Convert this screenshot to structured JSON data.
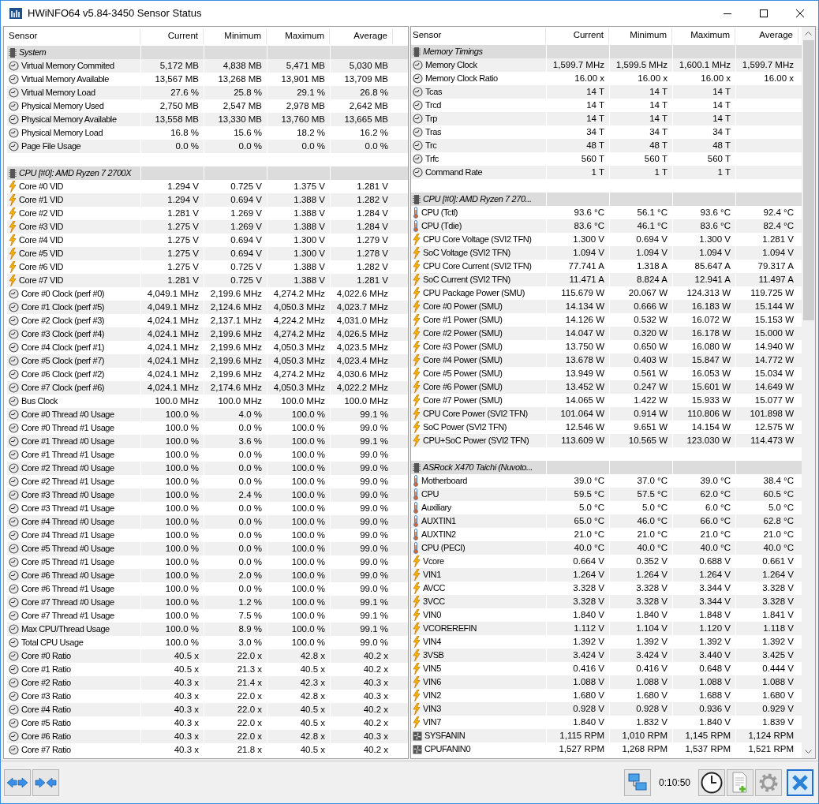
{
  "window": {
    "title": "HWiNFO64 v5.84-3450 Sensor Status"
  },
  "panes": [
    {
      "columns": [
        "Sensor",
        "Current",
        "Minimum",
        "Maximum",
        "Average"
      ],
      "rows": [
        {
          "kind": "group",
          "name": "System"
        },
        {
          "kind": "clock",
          "name": "Virtual Memory Commited",
          "values": [
            "5,172 MB",
            "4,838 MB",
            "5,471 MB",
            "5,030 MB"
          ]
        },
        {
          "kind": "clock",
          "name": "Virtual Memory Available",
          "values": [
            "13,567 MB",
            "13,268 MB",
            "13,901 MB",
            "13,709 MB"
          ]
        },
        {
          "kind": "clock",
          "name": "Virtual Memory Load",
          "values": [
            "27.6 %",
            "25.8 %",
            "29.1 %",
            "26.8 %"
          ]
        },
        {
          "kind": "clock",
          "name": "Physical Memory Used",
          "values": [
            "2,750 MB",
            "2,547 MB",
            "2,978 MB",
            "2,642 MB"
          ]
        },
        {
          "kind": "clock",
          "name": "Physical Memory Available",
          "values": [
            "13,558 MB",
            "13,330 MB",
            "13,760 MB",
            "13,665 MB"
          ]
        },
        {
          "kind": "clock",
          "name": "Physical Memory Load",
          "values": [
            "16.8 %",
            "15.6 %",
            "18.2 %",
            "16.2 %"
          ]
        },
        {
          "kind": "clock",
          "name": "Page File Usage",
          "values": [
            "0.0 %",
            "0.0 %",
            "0.0 %",
            "0.0 %"
          ]
        },
        {
          "kind": "spacer"
        },
        {
          "kind": "group",
          "name": "CPU [#0]: AMD Ryzen 7 2700X"
        },
        {
          "kind": "voltage",
          "name": "Core #0 VID",
          "values": [
            "1.294 V",
            "0.725 V",
            "1.375 V",
            "1.281 V"
          ]
        },
        {
          "kind": "voltage",
          "name": "Core #1 VID",
          "values": [
            "1.294 V",
            "0.694 V",
            "1.388 V",
            "1.282 V"
          ]
        },
        {
          "kind": "voltage",
          "name": "Core #2 VID",
          "values": [
            "1.281 V",
            "1.269 V",
            "1.388 V",
            "1.284 V"
          ]
        },
        {
          "kind": "voltage",
          "name": "Core #3 VID",
          "values": [
            "1.275 V",
            "1.269 V",
            "1.388 V",
            "1.284 V"
          ]
        },
        {
          "kind": "voltage",
          "name": "Core #4 VID",
          "values": [
            "1.275 V",
            "0.694 V",
            "1.300 V",
            "1.279 V"
          ]
        },
        {
          "kind": "voltage",
          "name": "Core #5 VID",
          "values": [
            "1.275 V",
            "0.694 V",
            "1.300 V",
            "1.278 V"
          ]
        },
        {
          "kind": "voltage",
          "name": "Core #6 VID",
          "values": [
            "1.275 V",
            "0.725 V",
            "1.388 V",
            "1.282 V"
          ]
        },
        {
          "kind": "voltage",
          "name": "Core #7 VID",
          "values": [
            "1.281 V",
            "0.725 V",
            "1.388 V",
            "1.281 V"
          ]
        },
        {
          "kind": "clock",
          "name": "Core #0 Clock (perf #0)",
          "values": [
            "4,049.1 MHz",
            "2,199.6 MHz",
            "4,274.2 MHz",
            "4,022.6 MHz"
          ]
        },
        {
          "kind": "clock",
          "name": "Core #1 Clock (perf #5)",
          "values": [
            "4,049.1 MHz",
            "2,124.6 MHz",
            "4,050.3 MHz",
            "4,023.7 MHz"
          ]
        },
        {
          "kind": "clock",
          "name": "Core #2 Clock (perf #3)",
          "values": [
            "4,024.1 MHz",
            "2,137.1 MHz",
            "4,224.2 MHz",
            "4,031.0 MHz"
          ]
        },
        {
          "kind": "clock",
          "name": "Core #3 Clock (perf #4)",
          "values": [
            "4,024.1 MHz",
            "2,199.6 MHz",
            "4,274.2 MHz",
            "4,026.5 MHz"
          ]
        },
        {
          "kind": "clock",
          "name": "Core #4 Clock (perf #1)",
          "values": [
            "4,024.1 MHz",
            "2,199.6 MHz",
            "4,050.3 MHz",
            "4,023.5 MHz"
          ]
        },
        {
          "kind": "clock",
          "name": "Core #5 Clock (perf #7)",
          "values": [
            "4,024.1 MHz",
            "2,199.6 MHz",
            "4,050.3 MHz",
            "4,023.4 MHz"
          ]
        },
        {
          "kind": "clock",
          "name": "Core #6 Clock (perf #2)",
          "values": [
            "4,024.1 MHz",
            "2,199.6 MHz",
            "4,274.2 MHz",
            "4,030.6 MHz"
          ]
        },
        {
          "kind": "clock",
          "name": "Core #7 Clock (perf #6)",
          "values": [
            "4,024.1 MHz",
            "2,174.6 MHz",
            "4,050.3 MHz",
            "4,022.2 MHz"
          ]
        },
        {
          "kind": "clock",
          "name": "Bus Clock",
          "values": [
            "100.0 MHz",
            "100.0 MHz",
            "100.0 MHz",
            "100.0 MHz"
          ]
        },
        {
          "kind": "clock",
          "name": "Core #0 Thread #0 Usage",
          "values": [
            "100.0 %",
            "4.0 %",
            "100.0 %",
            "99.1 %"
          ]
        },
        {
          "kind": "clock",
          "name": "Core #0 Thread #1 Usage",
          "values": [
            "100.0 %",
            "0.0 %",
            "100.0 %",
            "99.0 %"
          ]
        },
        {
          "kind": "clock",
          "name": "Core #1 Thread #0 Usage",
          "values": [
            "100.0 %",
            "3.6 %",
            "100.0 %",
            "99.1 %"
          ]
        },
        {
          "kind": "clock",
          "name": "Core #1 Thread #1 Usage",
          "values": [
            "100.0 %",
            "0.0 %",
            "100.0 %",
            "99.0 %"
          ]
        },
        {
          "kind": "clock",
          "name": "Core #2 Thread #0 Usage",
          "values": [
            "100.0 %",
            "0.0 %",
            "100.0 %",
            "99.0 %"
          ]
        },
        {
          "kind": "clock",
          "name": "Core #2 Thread #1 Usage",
          "values": [
            "100.0 %",
            "0.0 %",
            "100.0 %",
            "99.0 %"
          ]
        },
        {
          "kind": "clock",
          "name": "Core #3 Thread #0 Usage",
          "values": [
            "100.0 %",
            "2.4 %",
            "100.0 %",
            "99.0 %"
          ]
        },
        {
          "kind": "clock",
          "name": "Core #3 Thread #1 Usage",
          "values": [
            "100.0 %",
            "0.0 %",
            "100.0 %",
            "99.0 %"
          ]
        },
        {
          "kind": "clock",
          "name": "Core #4 Thread #0 Usage",
          "values": [
            "100.0 %",
            "0.0 %",
            "100.0 %",
            "99.0 %"
          ]
        },
        {
          "kind": "clock",
          "name": "Core #4 Thread #1 Usage",
          "values": [
            "100.0 %",
            "0.0 %",
            "100.0 %",
            "99.0 %"
          ]
        },
        {
          "kind": "clock",
          "name": "Core #5 Thread #0 Usage",
          "values": [
            "100.0 %",
            "0.0 %",
            "100.0 %",
            "99.0 %"
          ]
        },
        {
          "kind": "clock",
          "name": "Core #5 Thread #1 Usage",
          "values": [
            "100.0 %",
            "0.0 %",
            "100.0 %",
            "99.0 %"
          ]
        },
        {
          "kind": "clock",
          "name": "Core #6 Thread #0 Usage",
          "values": [
            "100.0 %",
            "2.0 %",
            "100.0 %",
            "99.0 %"
          ]
        },
        {
          "kind": "clock",
          "name": "Core #6 Thread #1 Usage",
          "values": [
            "100.0 %",
            "0.0 %",
            "100.0 %",
            "99.0 %"
          ]
        },
        {
          "kind": "clock",
          "name": "Core #7 Thread #0 Usage",
          "values": [
            "100.0 %",
            "1.2 %",
            "100.0 %",
            "99.1 %"
          ]
        },
        {
          "kind": "clock",
          "name": "Core #7 Thread #1 Usage",
          "values": [
            "100.0 %",
            "7.5 %",
            "100.0 %",
            "99.1 %"
          ]
        },
        {
          "kind": "clock",
          "name": "Max CPU/Thread Usage",
          "values": [
            "100.0 %",
            "8.9 %",
            "100.0 %",
            "99.1 %"
          ]
        },
        {
          "kind": "clock",
          "name": "Total CPU Usage",
          "values": [
            "100.0 %",
            "3.0 %",
            "100.0 %",
            "99.0 %"
          ]
        },
        {
          "kind": "clock",
          "name": "Core #0 Ratio",
          "values": [
            "40.5 x",
            "22.0 x",
            "42.8 x",
            "40.2 x"
          ]
        },
        {
          "kind": "clock",
          "name": "Core #1 Ratio",
          "values": [
            "40.5 x",
            "21.3 x",
            "40.5 x",
            "40.2 x"
          ]
        },
        {
          "kind": "clock",
          "name": "Core #2 Ratio",
          "values": [
            "40.3 x",
            "21.4 x",
            "42.3 x",
            "40.3 x"
          ]
        },
        {
          "kind": "clock",
          "name": "Core #3 Ratio",
          "values": [
            "40.3 x",
            "22.0 x",
            "42.8 x",
            "40.3 x"
          ]
        },
        {
          "kind": "clock",
          "name": "Core #4 Ratio",
          "values": [
            "40.3 x",
            "22.0 x",
            "40.5 x",
            "40.2 x"
          ]
        },
        {
          "kind": "clock",
          "name": "Core #5 Ratio",
          "values": [
            "40.3 x",
            "22.0 x",
            "40.5 x",
            "40.2 x"
          ]
        },
        {
          "kind": "clock",
          "name": "Core #6 Ratio",
          "values": [
            "40.3 x",
            "22.0 x",
            "42.8 x",
            "40.3 x"
          ]
        },
        {
          "kind": "clock",
          "name": "Core #7 Ratio",
          "values": [
            "40.3 x",
            "21.8 x",
            "40.5 x",
            "40.2 x"
          ]
        }
      ]
    },
    {
      "columns": [
        "Sensor",
        "Current",
        "Minimum",
        "Maximum",
        "Average"
      ],
      "rows": [
        {
          "kind": "group",
          "name": "Memory Timings"
        },
        {
          "kind": "clock",
          "name": "Memory Clock",
          "values": [
            "1,599.7 MHz",
            "1,599.5 MHz",
            "1,600.1 MHz",
            "1,599.7 MHz"
          ]
        },
        {
          "kind": "clock",
          "name": "Memory Clock Ratio",
          "values": [
            "16.00 x",
            "16.00 x",
            "16.00 x",
            "16.00 x"
          ]
        },
        {
          "kind": "clock",
          "name": "Tcas",
          "values": [
            "14 T",
            "14 T",
            "14 T"
          ]
        },
        {
          "kind": "clock",
          "name": "Trcd",
          "values": [
            "14 T",
            "14 T",
            "14 T"
          ]
        },
        {
          "kind": "clock",
          "name": "Trp",
          "values": [
            "14 T",
            "14 T",
            "14 T"
          ]
        },
        {
          "kind": "clock",
          "name": "Tras",
          "values": [
            "34 T",
            "34 T",
            "34 T"
          ]
        },
        {
          "kind": "clock",
          "name": "Trc",
          "values": [
            "48 T",
            "48 T",
            "48 T"
          ]
        },
        {
          "kind": "clock",
          "name": "Trfc",
          "values": [
            "560 T",
            "560 T",
            "560 T"
          ]
        },
        {
          "kind": "clock",
          "name": "Command Rate",
          "values": [
            "1 T",
            "1 T",
            "1 T"
          ]
        },
        {
          "kind": "spacer"
        },
        {
          "kind": "group",
          "name": "CPU [#0]: AMD Ryzen 7 270..."
        },
        {
          "kind": "temperature",
          "name": "CPU (Tctl)",
          "values": [
            "93.6 °C",
            "56.1 °C",
            "93.6 °C",
            "92.4 °C"
          ]
        },
        {
          "kind": "temperature",
          "name": "CPU (Tdie)",
          "values": [
            "83.6 °C",
            "46.1 °C",
            "83.6 °C",
            "82.4 °C"
          ]
        },
        {
          "kind": "voltage",
          "name": "CPU Core Voltage (SVI2 TFN)",
          "values": [
            "1.300 V",
            "0.694 V",
            "1.300 V",
            "1.281 V"
          ]
        },
        {
          "kind": "voltage",
          "name": "SoC Voltage (SVI2 TFN)",
          "values": [
            "1.094 V",
            "1.094 V",
            "1.094 V",
            "1.094 V"
          ]
        },
        {
          "kind": "voltage",
          "name": "CPU Core Current (SVI2 TFN)",
          "values": [
            "77.741 A",
            "1.318 A",
            "85.647 A",
            "79.317 A"
          ]
        },
        {
          "kind": "voltage",
          "name": "SoC Current (SVI2 TFN)",
          "values": [
            "11.471 A",
            "8.824 A",
            "12.941 A",
            "11.497 A"
          ]
        },
        {
          "kind": "voltage",
          "name": "CPU Package Power (SMU)",
          "values": [
            "115.679 W",
            "20.067 W",
            "124.313 W",
            "119.725 W"
          ]
        },
        {
          "kind": "voltage",
          "name": "Core #0 Power (SMU)",
          "values": [
            "14.134 W",
            "0.666 W",
            "16.183 W",
            "15.144 W"
          ]
        },
        {
          "kind": "voltage",
          "name": "Core #1 Power (SMU)",
          "values": [
            "14.126 W",
            "0.532 W",
            "16.072 W",
            "15.153 W"
          ]
        },
        {
          "kind": "voltage",
          "name": "Core #2 Power (SMU)",
          "values": [
            "14.047 W",
            "0.320 W",
            "16.178 W",
            "15.000 W"
          ]
        },
        {
          "kind": "voltage",
          "name": "Core #3 Power (SMU)",
          "values": [
            "13.750 W",
            "0.650 W",
            "16.080 W",
            "14.940 W"
          ]
        },
        {
          "kind": "voltage",
          "name": "Core #4 Power (SMU)",
          "values": [
            "13.678 W",
            "0.403 W",
            "15.847 W",
            "14.772 W"
          ]
        },
        {
          "kind": "voltage",
          "name": "Core #5 Power (SMU)",
          "values": [
            "13.949 W",
            "0.561 W",
            "16.053 W",
            "15.034 W"
          ]
        },
        {
          "kind": "voltage",
          "name": "Core #6 Power (SMU)",
          "values": [
            "13.452 W",
            "0.247 W",
            "15.601 W",
            "14.649 W"
          ]
        },
        {
          "kind": "voltage",
          "name": "Core #7 Power (SMU)",
          "values": [
            "14.065 W",
            "1.422 W",
            "15.933 W",
            "15.077 W"
          ]
        },
        {
          "kind": "voltage",
          "name": "CPU Core Power (SVI2 TFN)",
          "values": [
            "101.064 W",
            "0.914 W",
            "110.806 W",
            "101.898 W"
          ]
        },
        {
          "kind": "voltage",
          "name": "SoC Power (SVI2 TFN)",
          "values": [
            "12.546 W",
            "9.651 W",
            "14.154 W",
            "12.575 W"
          ]
        },
        {
          "kind": "voltage",
          "name": "CPU+SoC Power (SVI2 TFN)",
          "values": [
            "113.609 W",
            "10.565 W",
            "123.030 W",
            "114.473 W"
          ]
        },
        {
          "kind": "spacer"
        },
        {
          "kind": "group",
          "name": "ASRock X470 Taichi (Nuvoto..."
        },
        {
          "kind": "temperature",
          "name": "Motherboard",
          "values": [
            "39.0 °C",
            "37.0 °C",
            "39.0 °C",
            "38.4 °C"
          ]
        },
        {
          "kind": "temperature",
          "name": "CPU",
          "values": [
            "59.5 °C",
            "57.5 °C",
            "62.0 °C",
            "60.5 °C"
          ]
        },
        {
          "kind": "temperature",
          "name": "Auxiliary",
          "values": [
            "5.0 °C",
            "5.0 °C",
            "6.0 °C",
            "5.0 °C"
          ]
        },
        {
          "kind": "temperature",
          "name": "AUXTIN1",
          "values": [
            "65.0 °C",
            "46.0 °C",
            "66.0 °C",
            "62.8 °C"
          ]
        },
        {
          "kind": "temperature",
          "name": "AUXTIN2",
          "values": [
            "21.0 °C",
            "21.0 °C",
            "21.0 °C",
            "21.0 °C"
          ]
        },
        {
          "kind": "temperature",
          "name": "CPU (PECI)",
          "values": [
            "40.0 °C",
            "40.0 °C",
            "40.0 °C",
            "40.0 °C"
          ]
        },
        {
          "kind": "voltage",
          "name": "Vcore",
          "values": [
            "0.664 V",
            "0.352 V",
            "0.688 V",
            "0.661 V"
          ]
        },
        {
          "kind": "voltage",
          "name": "VIN1",
          "values": [
            "1.264 V",
            "1.264 V",
            "1.264 V",
            "1.264 V"
          ]
        },
        {
          "kind": "voltage",
          "name": "AVCC",
          "values": [
            "3.328 V",
            "3.328 V",
            "3.344 V",
            "3.328 V"
          ]
        },
        {
          "kind": "voltage",
          "name": "3VCC",
          "values": [
            "3.328 V",
            "3.328 V",
            "3.344 V",
            "3.328 V"
          ]
        },
        {
          "kind": "voltage",
          "name": "VIN0",
          "values": [
            "1.840 V",
            "1.840 V",
            "1.848 V",
            "1.841 V"
          ]
        },
        {
          "kind": "voltage",
          "name": "VCOREREFIN",
          "values": [
            "1.112 V",
            "1.104 V",
            "1.120 V",
            "1.118 V"
          ]
        },
        {
          "kind": "voltage",
          "name": "VIN4",
          "values": [
            "1.392 V",
            "1.392 V",
            "1.392 V",
            "1.392 V"
          ]
        },
        {
          "kind": "voltage",
          "name": "3VSB",
          "values": [
            "3.424 V",
            "3.424 V",
            "3.440 V",
            "3.425 V"
          ]
        },
        {
          "kind": "voltage",
          "name": "VIN5",
          "values": [
            "0.416 V",
            "0.416 V",
            "0.648 V",
            "0.444 V"
          ]
        },
        {
          "kind": "voltage",
          "name": "VIN6",
          "values": [
            "1.088 V",
            "1.088 V",
            "1.088 V",
            "1.088 V"
          ]
        },
        {
          "kind": "voltage",
          "name": "VIN2",
          "values": [
            "1.680 V",
            "1.680 V",
            "1.688 V",
            "1.680 V"
          ]
        },
        {
          "kind": "voltage",
          "name": "VIN3",
          "values": [
            "0.928 V",
            "0.928 V",
            "0.936 V",
            "0.929 V"
          ]
        },
        {
          "kind": "voltage",
          "name": "VIN7",
          "values": [
            "1.840 V",
            "1.832 V",
            "1.840 V",
            "1.839 V"
          ]
        },
        {
          "kind": "fan",
          "name": "SYSFANIN",
          "values": [
            "1,115 RPM",
            "1,010 RPM",
            "1,145 RPM",
            "1,124 RPM"
          ]
        },
        {
          "kind": "fan",
          "name": "CPUFANIN0",
          "values": [
            "1,527 RPM",
            "1,268 RPM",
            "1,537 RPM",
            "1,521 RPM"
          ]
        }
      ]
    }
  ],
  "toolbar": {
    "timer": "0:10:50"
  }
}
